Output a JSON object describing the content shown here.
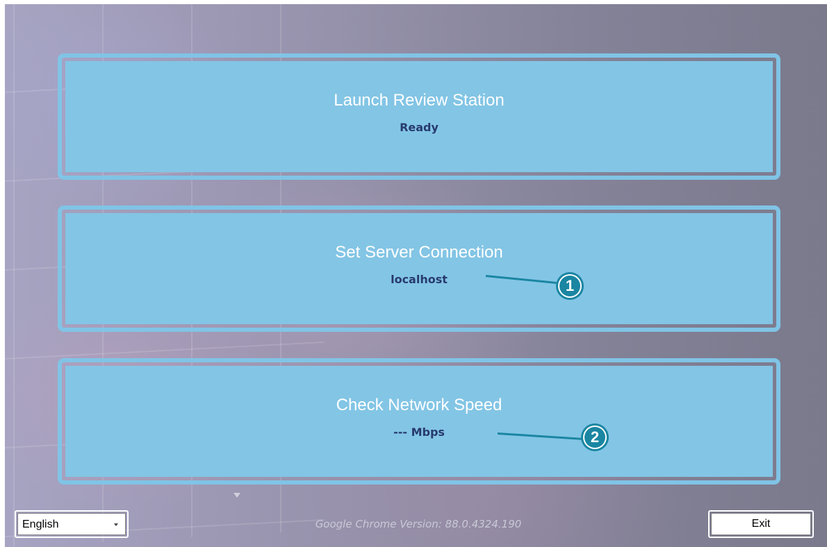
{
  "panels": [
    {
      "title": "Launch Review Station",
      "status": "Ready"
    },
    {
      "title": "Set Server Connection",
      "status": "localhost"
    },
    {
      "title": "Check Network Speed",
      "status": "--- Mbps"
    }
  ],
  "callouts": [
    {
      "number": "1"
    },
    {
      "number": "2"
    }
  ],
  "footer": {
    "language": "English",
    "version_label": "Google Chrome Version:  88.0.4324.190",
    "exit_label": "Exit"
  },
  "colors": {
    "panel": "#83c5e5",
    "callout": "#1a86a2",
    "status_text": "#273a6e"
  }
}
